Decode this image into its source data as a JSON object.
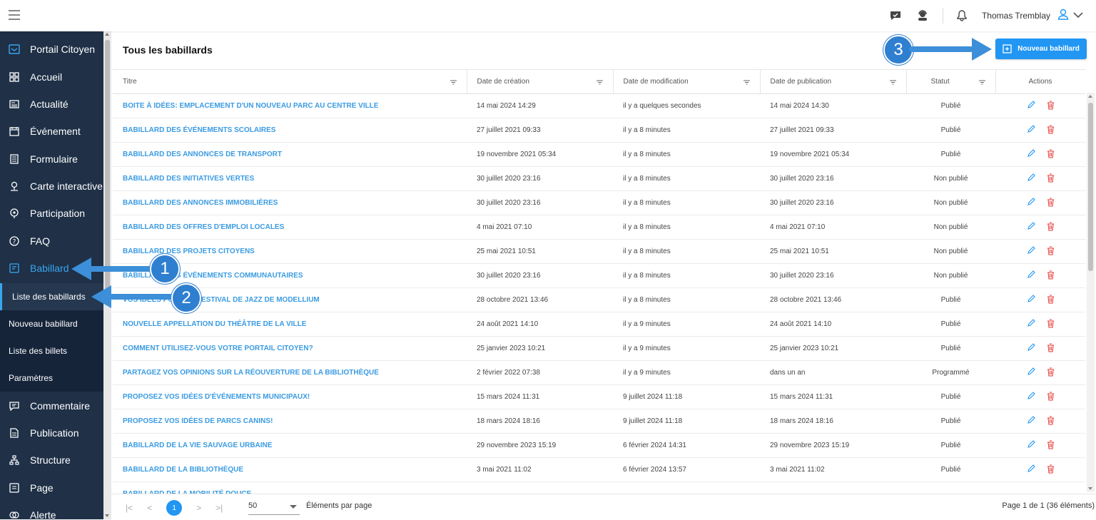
{
  "topbar": {
    "user_name": "Thomas Tremblay"
  },
  "sidebar": {
    "brand": "Portail Citoyen",
    "items": [
      {
        "label": "Accueil",
        "icon": "grid-icon"
      },
      {
        "label": "Actualité",
        "icon": "news-icon"
      },
      {
        "label": "Événement",
        "icon": "calendar-icon"
      },
      {
        "label": "Formulaire",
        "icon": "form-icon"
      },
      {
        "label": "Carte interactive",
        "icon": "map-pin-icon"
      },
      {
        "label": "Participation",
        "icon": "participation-icon"
      },
      {
        "label": "FAQ",
        "icon": "question-icon"
      },
      {
        "label": "Babillard",
        "icon": "board-icon"
      }
    ],
    "sub_items": [
      {
        "label": "Liste des babillards"
      },
      {
        "label": "Nouveau babillard"
      },
      {
        "label": "Liste des billets"
      },
      {
        "label": "Paramètres"
      }
    ],
    "items_after": [
      {
        "label": "Commentaire",
        "icon": "comment-icon"
      },
      {
        "label": "Publication",
        "icon": "document-icon"
      },
      {
        "label": "Structure",
        "icon": "structure-icon"
      },
      {
        "label": "Page",
        "icon": "page-icon"
      },
      {
        "label": "Alerte",
        "icon": "alert-icon"
      }
    ]
  },
  "main": {
    "title": "Tous les babillards",
    "new_button": "Nouveau babillard",
    "columns": [
      "Titre",
      "Date de création",
      "Date de modification",
      "Date de publication",
      "Statut",
      "Actions"
    ],
    "rows": [
      [
        "Boite à idées: Emplacement d'un nouveau parc au centre ville",
        "14 mai 2024 14:29",
        "il y a quelques secondes",
        "14 mai 2024 14:30",
        "Publié"
      ],
      [
        "Babillard des événements scolaires",
        "27 juillet 2021 09:33",
        "il y a 8 minutes",
        "27 juillet 2021 09:33",
        "Publié"
      ],
      [
        "Babillard des annonces de transport",
        "19 novembre 2021 05:34",
        "il y a 8 minutes",
        "19 novembre 2021 05:34",
        "Publié"
      ],
      [
        "Babillard des initiatives vertes",
        "30 juillet 2020 23:16",
        "il y a 8 minutes",
        "30 juillet 2020 23:16",
        "Non publié"
      ],
      [
        "Babillard des annonces immobilières",
        "30 juillet 2020 23:16",
        "il y a 8 minutes",
        "30 juillet 2020 23:16",
        "Non publié"
      ],
      [
        "Babillard des offres d'emploi locales",
        "4 mai 2021 07:10",
        "il y a 8 minutes",
        "4 mai 2021 07:10",
        "Non publié"
      ],
      [
        "Babillard des projets citoyens",
        "25 mai 2021 10:51",
        "il y a 8 minutes",
        "25 mai 2021 10:51",
        "Non publié"
      ],
      [
        "Babillard des événements communautaires",
        "30 juillet 2020 23:16",
        "il y a 8 minutes",
        "30 juillet 2020 23:16",
        "Non publié"
      ],
      [
        "Vos idées pour le festival de jazz de Modellium",
        "28 octobre 2021 13:46",
        "il y a 8 minutes",
        "28 octobre 2021 13:46",
        "Publié"
      ],
      [
        "Nouvelle appellation du théâtre de la ville",
        "24 août 2021 14:10",
        "il y a 9 minutes",
        "24 août 2021 14:10",
        "Publié"
      ],
      [
        "Comment utilisez-vous votre portail citoyen?",
        "25 janvier 2023 10:21",
        "il y a 9 minutes",
        "25 janvier 2023 10:21",
        "Publié"
      ],
      [
        "Partagez vos opinions sur la réouverture de la bibliothèque",
        "2 février 2022 07:38",
        "il y a 9 minutes",
        "dans un an",
        "Programmé"
      ],
      [
        "Proposez vos idées d'événements municipaux!",
        "15 mars 2024 11:31",
        "9 juillet 2024 11:18",
        "15 mars 2024 11:31",
        "Publié"
      ],
      [
        "Proposez vos idées de parcs canins!",
        "18 mars 2024 18:16",
        "9 juillet 2024 11:18",
        "18 mars 2024 18:16",
        "Publié"
      ],
      [
        "Babillard de la vie sauvage urbaine",
        "29 novembre 2023 15:19",
        "6 février 2024 14:31",
        "29 novembre 2023 15:19",
        "Publié"
      ],
      [
        "Babillard de la bibliothèque",
        "3 mai 2021 11:02",
        "6 février 2024 13:57",
        "3 mai 2021 11:02",
        "Publié"
      ],
      [
        "Babillard de la mobilité douce",
        "",
        "",
        "",
        ""
      ]
    ]
  },
  "footer": {
    "current_page": "1",
    "per_page": "50",
    "per_page_label": "Éléments par page",
    "page_info": "Page 1 de 1 (36 éléments)"
  },
  "annotations": [
    "1",
    "2",
    "3"
  ],
  "colors": {
    "sidebar_bg": "#1f3047",
    "accent": "#2196f3",
    "link": "#3a9be2",
    "delete": "#e53935",
    "annotation": "#2f7fd0"
  }
}
